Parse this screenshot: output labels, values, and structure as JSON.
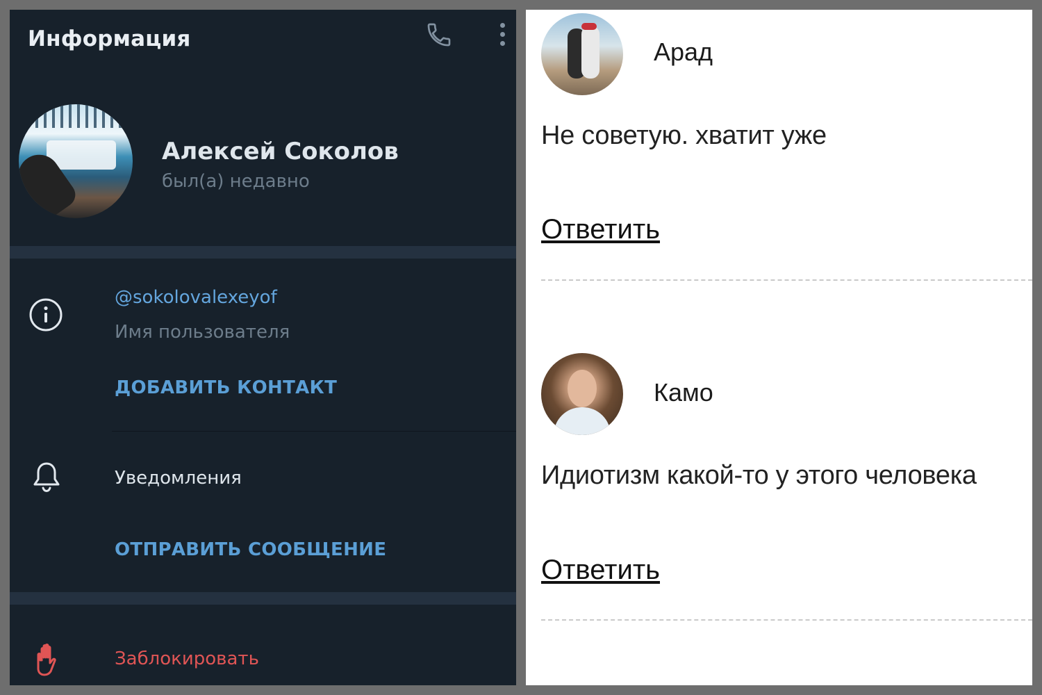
{
  "colors": {
    "dark_panel_bg": "#17212b",
    "accent_blue": "#5b9fd6",
    "danger_red": "#e05555",
    "muted_text": "#6d7d8b",
    "comments_bg": "#ffffff"
  },
  "profile_panel": {
    "title": "Информация",
    "icons": [
      "phone-icon",
      "more-vertical-icon",
      "info-icon",
      "bell-icon",
      "hand-stop-icon"
    ],
    "user": {
      "name": "Алексей Соколов",
      "status": "был(а) недавно"
    },
    "username": {
      "value": "@sokolovalexeyof",
      "caption": "Имя пользователя"
    },
    "add_contact_label": "ДОБАВИТЬ КОНТАКТ",
    "notifications_label": "Уведомления",
    "send_message_label": "ОТПРАВИТЬ СООБЩЕНИЕ",
    "block_label": "Заблокировать"
  },
  "comments": [
    {
      "author": "Арад",
      "text": "Не советую. хватит уже",
      "reply_label": "Ответить"
    },
    {
      "author": "Камо",
      "text": "Идиотизм какой-то у этого человека",
      "reply_label": "Ответить"
    }
  ]
}
